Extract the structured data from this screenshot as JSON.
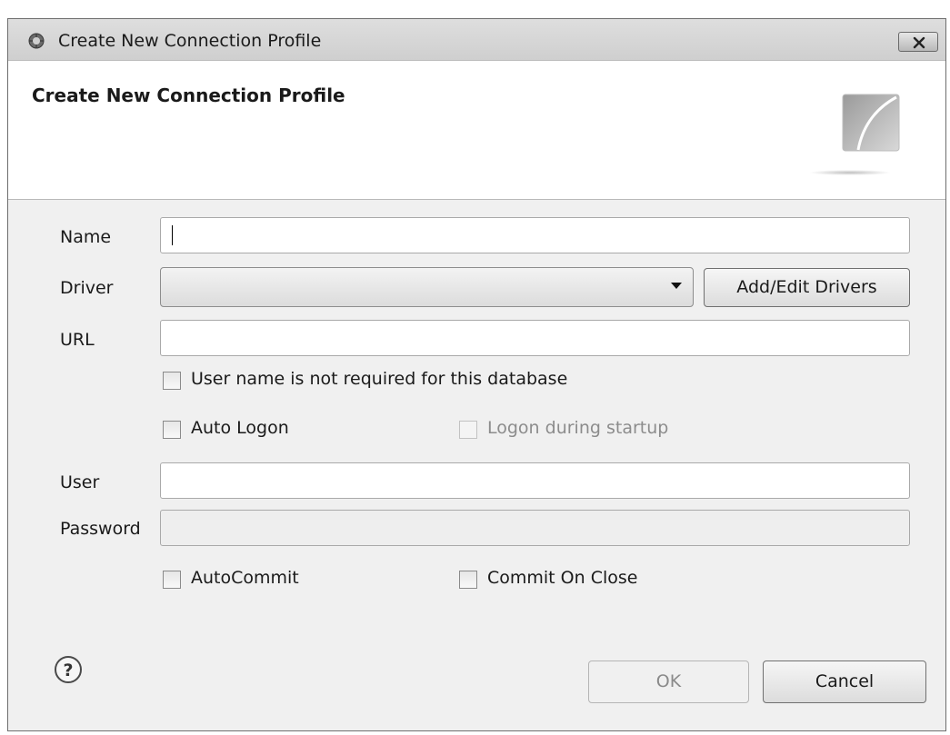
{
  "window": {
    "title": "Create New Connection Profile",
    "close_icon": "close-icon",
    "app_icon": "app-icon"
  },
  "header": {
    "title": "Create New Connection Profile",
    "image": "wizard-banner-icon"
  },
  "form": {
    "name": {
      "label": "Name",
      "value": ""
    },
    "driver": {
      "label": "Driver",
      "value": "",
      "button_label": "Add/Edit Drivers"
    },
    "url": {
      "label": "URL",
      "value": ""
    },
    "user_not_required": {
      "label": "User name is not required for this database",
      "checked": false
    },
    "auto_logon": {
      "label": "Auto Logon",
      "checked": false
    },
    "logon_startup": {
      "label": "Logon during startup",
      "checked": false,
      "enabled": false
    },
    "user": {
      "label": "User",
      "value": ""
    },
    "password": {
      "label": "Password",
      "value": "",
      "enabled": false
    },
    "autocommit": {
      "label": "AutoCommit",
      "checked": false
    },
    "commit_on_close": {
      "label": "Commit On Close",
      "checked": false
    }
  },
  "footer": {
    "help_icon": "help-icon",
    "ok_label": "OK",
    "ok_enabled": false,
    "cancel_label": "Cancel"
  },
  "colors": {
    "titlebar": "#d4d4d4",
    "dialog_bg": "#f0f0f0",
    "header_bg": "#ffffff"
  }
}
